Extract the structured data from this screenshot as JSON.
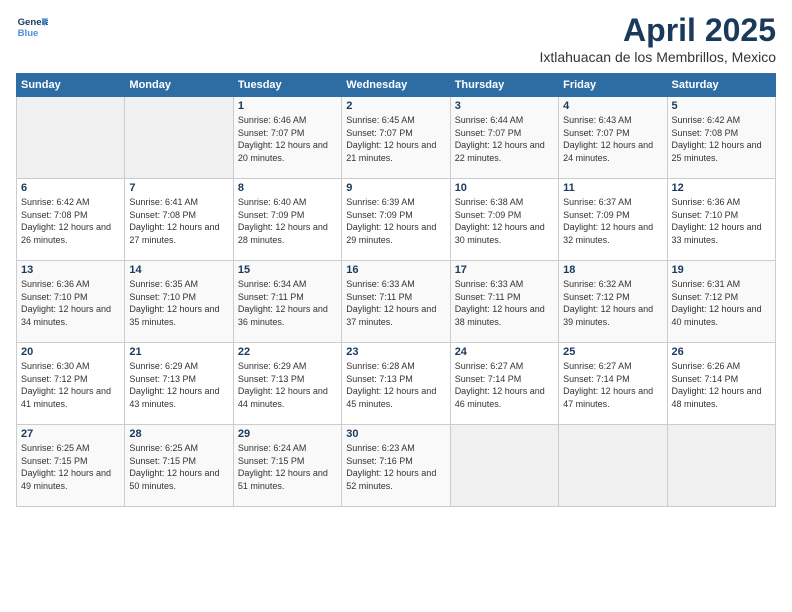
{
  "logo": {
    "line1": "General",
    "line2": "Blue"
  },
  "title": "April 2025",
  "location": "Ixtlahuacan de los Membrillos, Mexico",
  "days_of_week": [
    "Sunday",
    "Monday",
    "Tuesday",
    "Wednesday",
    "Thursday",
    "Friday",
    "Saturday"
  ],
  "weeks": [
    [
      {
        "day": null
      },
      {
        "day": null
      },
      {
        "day": 1,
        "sunrise": "6:46 AM",
        "sunset": "7:07 PM",
        "daylight": "12 hours and 20 minutes."
      },
      {
        "day": 2,
        "sunrise": "6:45 AM",
        "sunset": "7:07 PM",
        "daylight": "12 hours and 21 minutes."
      },
      {
        "day": 3,
        "sunrise": "6:44 AM",
        "sunset": "7:07 PM",
        "daylight": "12 hours and 22 minutes."
      },
      {
        "day": 4,
        "sunrise": "6:43 AM",
        "sunset": "7:07 PM",
        "daylight": "12 hours and 24 minutes."
      },
      {
        "day": 5,
        "sunrise": "6:42 AM",
        "sunset": "7:08 PM",
        "daylight": "12 hours and 25 minutes."
      }
    ],
    [
      {
        "day": 6,
        "sunrise": "6:42 AM",
        "sunset": "7:08 PM",
        "daylight": "12 hours and 26 minutes."
      },
      {
        "day": 7,
        "sunrise": "6:41 AM",
        "sunset": "7:08 PM",
        "daylight": "12 hours and 27 minutes."
      },
      {
        "day": 8,
        "sunrise": "6:40 AM",
        "sunset": "7:09 PM",
        "daylight": "12 hours and 28 minutes."
      },
      {
        "day": 9,
        "sunrise": "6:39 AM",
        "sunset": "7:09 PM",
        "daylight": "12 hours and 29 minutes."
      },
      {
        "day": 10,
        "sunrise": "6:38 AM",
        "sunset": "7:09 PM",
        "daylight": "12 hours and 30 minutes."
      },
      {
        "day": 11,
        "sunrise": "6:37 AM",
        "sunset": "7:09 PM",
        "daylight": "12 hours and 32 minutes."
      },
      {
        "day": 12,
        "sunrise": "6:36 AM",
        "sunset": "7:10 PM",
        "daylight": "12 hours and 33 minutes."
      }
    ],
    [
      {
        "day": 13,
        "sunrise": "6:36 AM",
        "sunset": "7:10 PM",
        "daylight": "12 hours and 34 minutes."
      },
      {
        "day": 14,
        "sunrise": "6:35 AM",
        "sunset": "7:10 PM",
        "daylight": "12 hours and 35 minutes."
      },
      {
        "day": 15,
        "sunrise": "6:34 AM",
        "sunset": "7:11 PM",
        "daylight": "12 hours and 36 minutes."
      },
      {
        "day": 16,
        "sunrise": "6:33 AM",
        "sunset": "7:11 PM",
        "daylight": "12 hours and 37 minutes."
      },
      {
        "day": 17,
        "sunrise": "6:33 AM",
        "sunset": "7:11 PM",
        "daylight": "12 hours and 38 minutes."
      },
      {
        "day": 18,
        "sunrise": "6:32 AM",
        "sunset": "7:12 PM",
        "daylight": "12 hours and 39 minutes."
      },
      {
        "day": 19,
        "sunrise": "6:31 AM",
        "sunset": "7:12 PM",
        "daylight": "12 hours and 40 minutes."
      }
    ],
    [
      {
        "day": 20,
        "sunrise": "6:30 AM",
        "sunset": "7:12 PM",
        "daylight": "12 hours and 41 minutes."
      },
      {
        "day": 21,
        "sunrise": "6:29 AM",
        "sunset": "7:13 PM",
        "daylight": "12 hours and 43 minutes."
      },
      {
        "day": 22,
        "sunrise": "6:29 AM",
        "sunset": "7:13 PM",
        "daylight": "12 hours and 44 minutes."
      },
      {
        "day": 23,
        "sunrise": "6:28 AM",
        "sunset": "7:13 PM",
        "daylight": "12 hours and 45 minutes."
      },
      {
        "day": 24,
        "sunrise": "6:27 AM",
        "sunset": "7:14 PM",
        "daylight": "12 hours and 46 minutes."
      },
      {
        "day": 25,
        "sunrise": "6:27 AM",
        "sunset": "7:14 PM",
        "daylight": "12 hours and 47 minutes."
      },
      {
        "day": 26,
        "sunrise": "6:26 AM",
        "sunset": "7:14 PM",
        "daylight": "12 hours and 48 minutes."
      }
    ],
    [
      {
        "day": 27,
        "sunrise": "6:25 AM",
        "sunset": "7:15 PM",
        "daylight": "12 hours and 49 minutes."
      },
      {
        "day": 28,
        "sunrise": "6:25 AM",
        "sunset": "7:15 PM",
        "daylight": "12 hours and 50 minutes."
      },
      {
        "day": 29,
        "sunrise": "6:24 AM",
        "sunset": "7:15 PM",
        "daylight": "12 hours and 51 minutes."
      },
      {
        "day": 30,
        "sunrise": "6:23 AM",
        "sunset": "7:16 PM",
        "daylight": "12 hours and 52 minutes."
      },
      {
        "day": null
      },
      {
        "day": null
      },
      {
        "day": null
      }
    ]
  ]
}
